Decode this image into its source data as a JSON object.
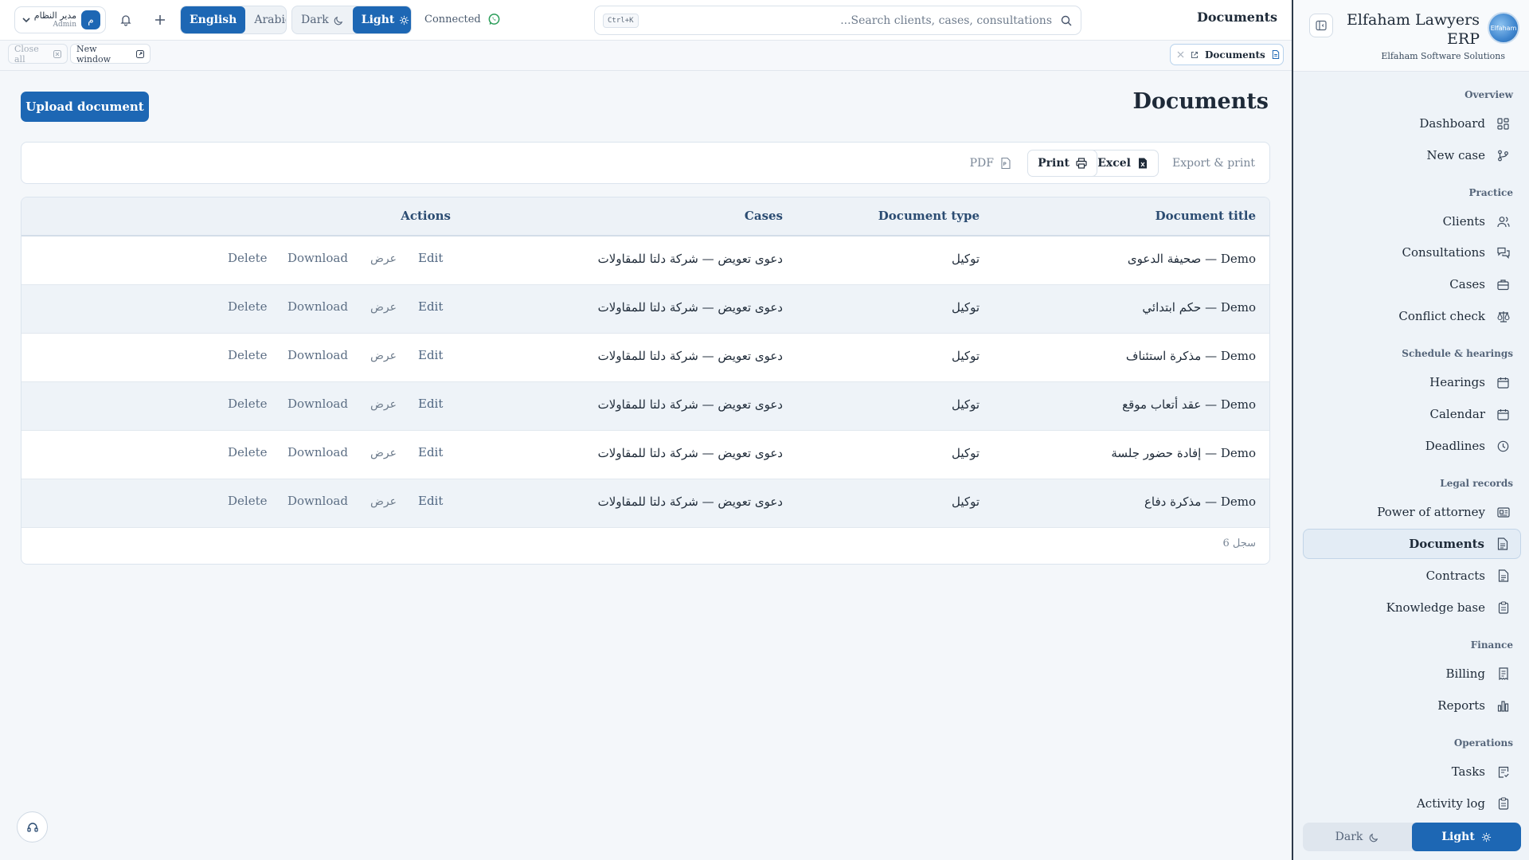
{
  "topbar": {
    "user": {
      "name": "مدير النظام",
      "role": "Admin",
      "avatar_letter": "م"
    },
    "language": {
      "options": [
        "English",
        "Arabic"
      ],
      "selected": "English"
    },
    "theme": {
      "dark_label": "Dark",
      "light_label": "Light",
      "selected": "Light"
    },
    "status": "Connected",
    "search": {
      "shortcut": "Ctrl+K",
      "placeholder": "...Search clients, cases, consultations"
    },
    "title": "Documents"
  },
  "tabbar": {
    "close_all": "Close all",
    "new_window": "New window",
    "open_tabs": [
      {
        "label": "Documents"
      }
    ]
  },
  "main": {
    "title": "Documents",
    "upload_button": "Upload document",
    "toolbar": {
      "export_print": "Export & print",
      "excel": "Excel",
      "print": "Print",
      "pdf": "PDF"
    },
    "table": {
      "columns": {
        "title": "Document title",
        "type": "Document type",
        "cases": "Cases",
        "actions": "Actions"
      },
      "actions": {
        "edit": "Edit",
        "view": "عرض",
        "download": "Download",
        "delete": "Delete"
      },
      "rows": [
        {
          "title": "صحيفة الدعوى — Demo",
          "type": "توكيل",
          "case": "دعوى تعويض — شركة دلتا للمقاولات"
        },
        {
          "title": "حكم ابتدائي — Demo",
          "type": "توكيل",
          "case": "دعوى تعويض — شركة دلتا للمقاولات"
        },
        {
          "title": "مذكرة استئناف — Demo",
          "type": "توكيل",
          "case": "دعوى تعويض — شركة دلتا للمقاولات"
        },
        {
          "title": "عقد أتعاب موقع — Demo",
          "type": "توكيل",
          "case": "دعوى تعويض — شركة دلتا للمقاولات"
        },
        {
          "title": "إفادة حضور جلسة — Demo",
          "type": "توكيل",
          "case": "دعوى تعويض — شركة دلتا للمقاولات"
        },
        {
          "title": "مذكرة دفاع — Demo",
          "type": "توكيل",
          "case": "دعوى تعويض — شركة دلتا للمقاولات"
        }
      ],
      "record_count": "6 سجل"
    }
  },
  "sidebar": {
    "brand": "Elfaham Lawyers ERP",
    "brand_sub": "Elfaham Software Solutions",
    "logo_text": "Elfaham",
    "sections": {
      "overview": "Overview",
      "practice": "Practice",
      "schedule": "Schedule & hearings",
      "legal": "Legal records",
      "finance": "Finance",
      "operations": "Operations"
    },
    "items": {
      "dashboard": "Dashboard",
      "new_case": "New case",
      "clients": "Clients",
      "consultations": "Consultations",
      "cases": "Cases",
      "conflict_check": "Conflict check",
      "hearings": "Hearings",
      "calendar": "Calendar",
      "deadlines": "Deadlines",
      "power_of_attorney": "Power of attorney",
      "documents": "Documents",
      "contracts": "Contracts",
      "knowledge_base": "Knowledge base",
      "billing": "Billing",
      "reports": "Reports",
      "tasks": "Tasks",
      "activity_log": "Activity log"
    },
    "active_item": "Documents",
    "theme": {
      "dark_label": "Dark",
      "light_label": "Light",
      "selected": "Light"
    }
  },
  "colors": {
    "primary": "#1d67b4",
    "connected": "#2a9d59",
    "header_text": "#2b4c72"
  }
}
